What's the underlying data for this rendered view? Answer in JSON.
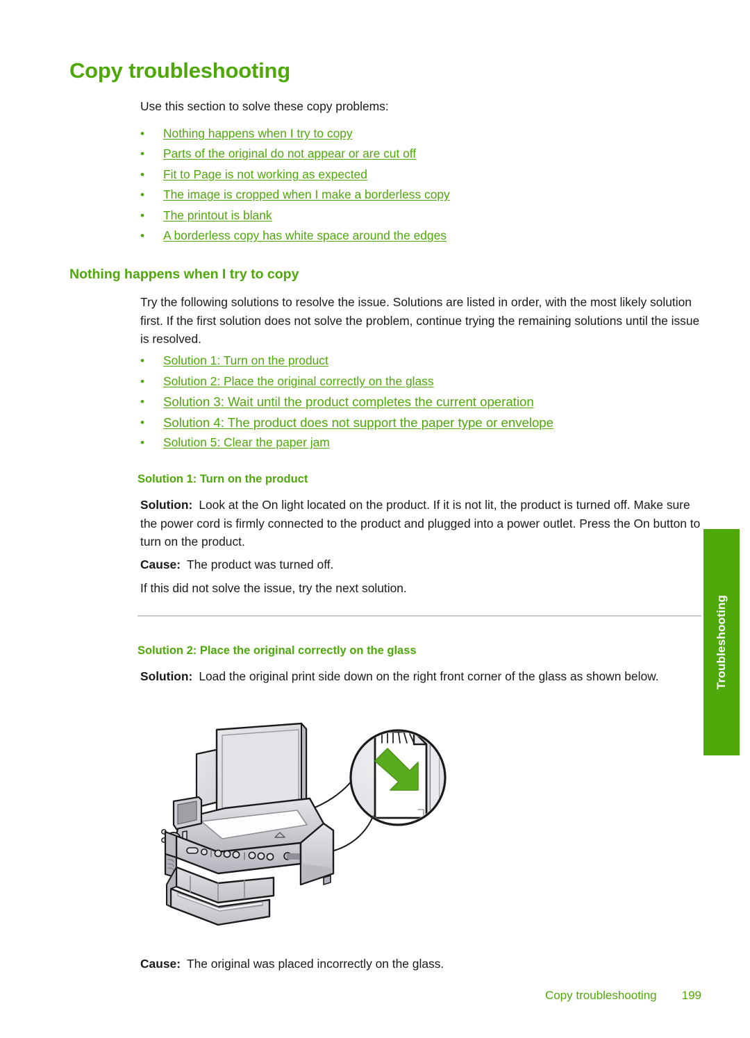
{
  "document": {
    "title": "Copy troubleshooting",
    "intro": "Use this section to solve these copy problems:"
  },
  "problem_links": [
    "Nothing happens when I try to copy",
    "Parts of the original do not appear or are cut off",
    "Fit to Page is not working as expected",
    "The image is cropped when I make a borderless copy",
    "The printout is blank",
    "A borderless copy has white space around the edges"
  ],
  "section": {
    "heading": "Nothing happens when I try to copy",
    "intro_paragraph": "Try the following solutions to resolve the issue. Solutions are listed in order, with the most likely solution first. If the first solution does not solve the problem, continue trying the remaining solutions until the issue is resolved."
  },
  "solution_links": [
    "Solution 1: Turn on the product",
    "Solution 2: Place the original correctly on the glass",
    "Solution 3: Wait until the product completes the current operation",
    "Solution 4: The product does not support the paper type or envelope",
    "Solution 5: Clear the paper jam"
  ],
  "solution1": {
    "heading": "Solution 1: Turn on the product",
    "solution_label": "Solution:",
    "solution_text": "Look at the On light located on the product. If it is not lit, the product is turned off. Make sure the power cord is firmly connected to the product and plugged into a power outlet. Press the On button to turn on the product.",
    "cause_label": "Cause:",
    "cause_text": "The product was turned off.",
    "followup": "If this did not solve the issue, try the next solution."
  },
  "solution2": {
    "heading": "Solution 2: Place the original correctly on the glass",
    "solution_label": "Solution:",
    "solution_text": "Load the original print side down on the right front corner of the glass as shown below.",
    "cause_label": "Cause:",
    "cause_text": "The original was placed incorrectly on the glass."
  },
  "illustration": {
    "name": "all-in-one-printer-load-original-diagram",
    "arrow_color": "#5aab1e",
    "body_color": "#c9cace",
    "outline_color": "#1a1a1a"
  },
  "side_tab": {
    "label": "Troubleshooting",
    "color": "#4fa80a"
  },
  "footer": {
    "chapter": "Copy troubleshooting",
    "page_number": "199"
  },
  "colors": {
    "accent_green": "#4fa80a",
    "body_text": "#1a1a1a",
    "divider": "#c9c9c9"
  }
}
